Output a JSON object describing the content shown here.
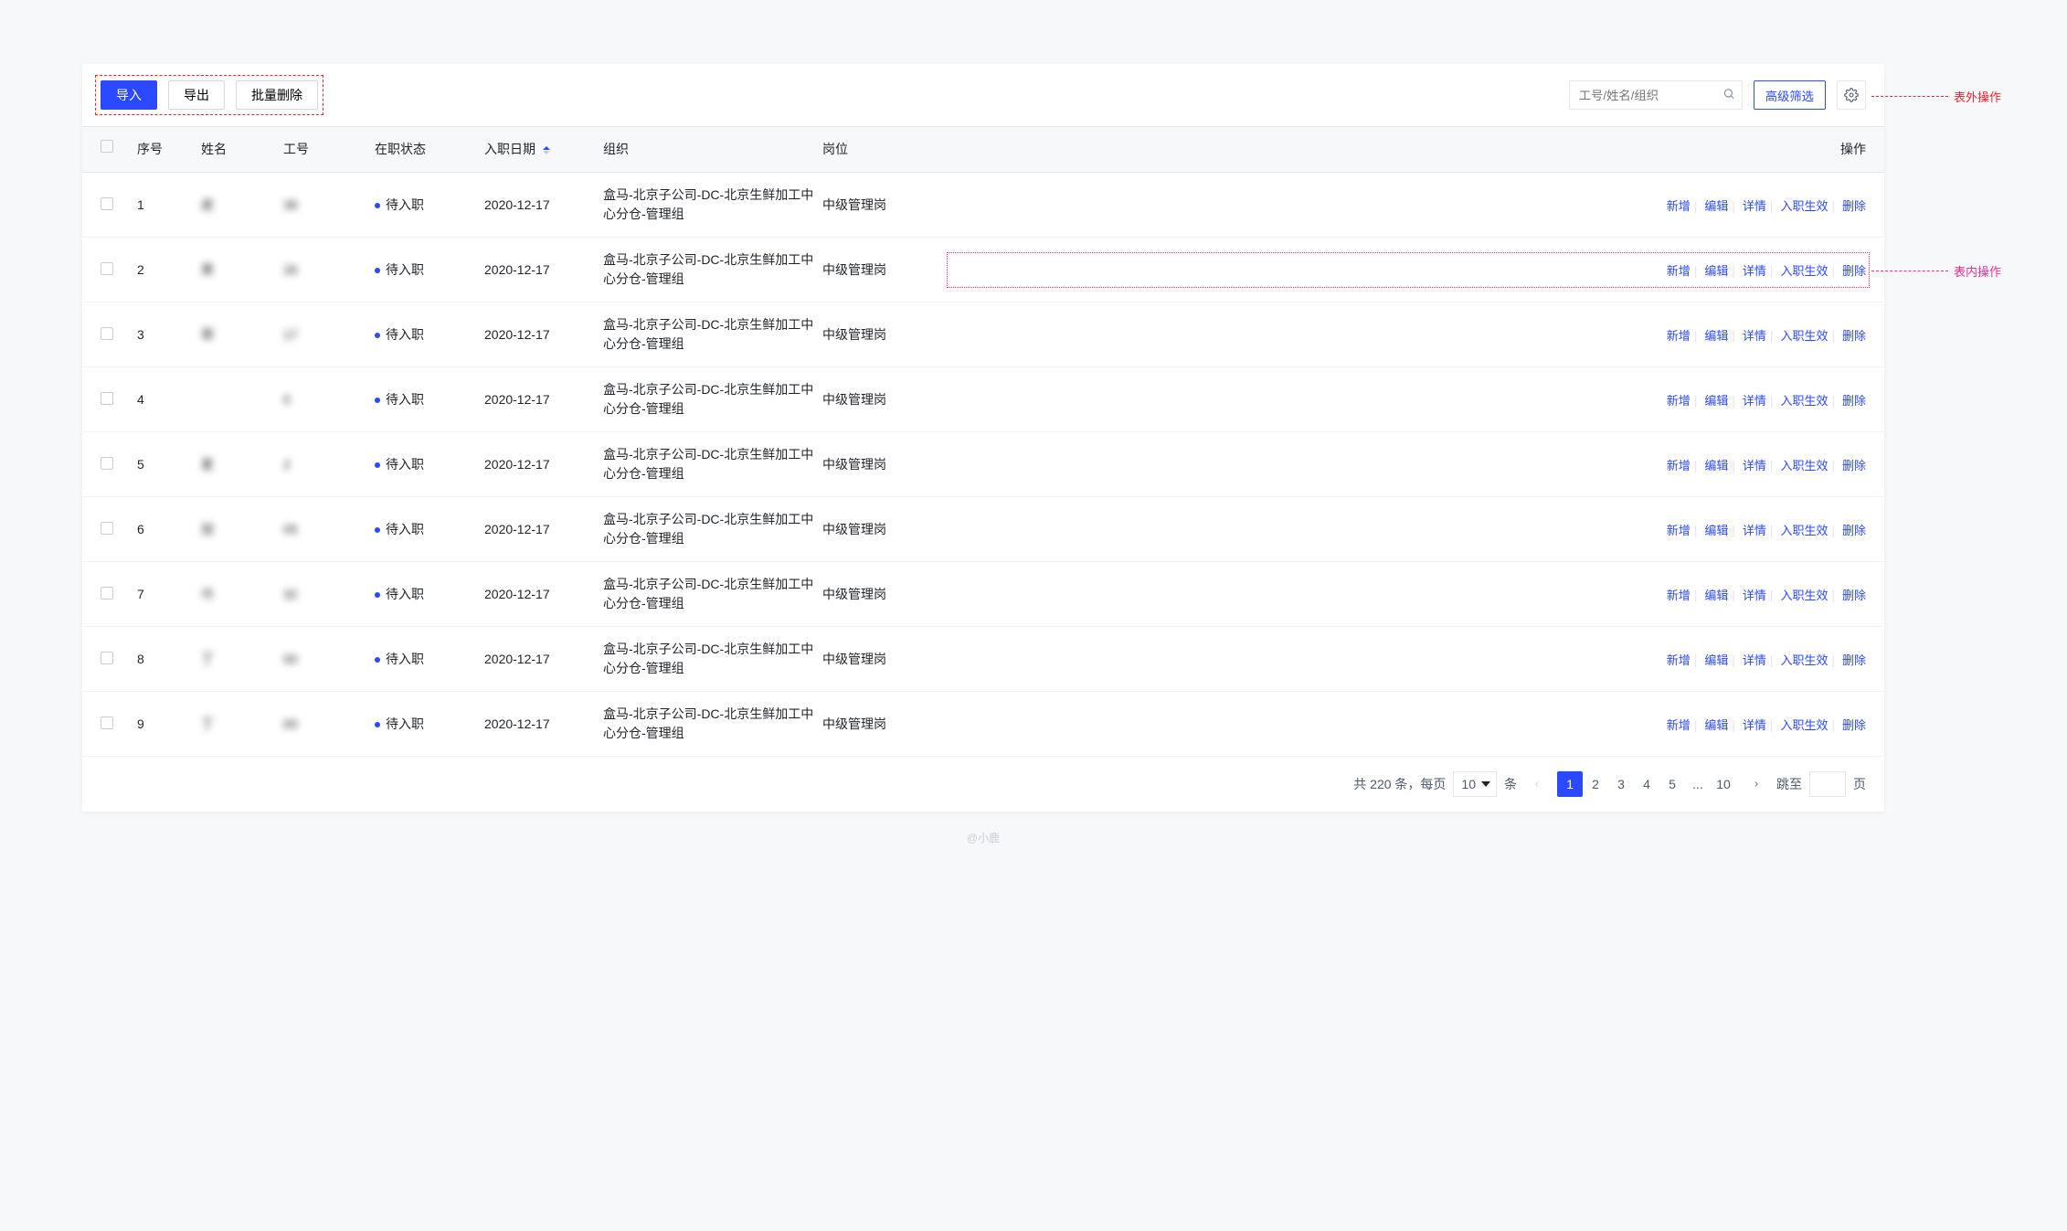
{
  "toolbar": {
    "import_label": "导入",
    "export_label": "导出",
    "batch_delete_label": "批量删除",
    "search_placeholder": "工号/姓名/组织",
    "adv_filter_label": "高级筛选"
  },
  "annotations": {
    "outer_action": "表外操作",
    "inner_action": "表内操作"
  },
  "columns": {
    "index": "序号",
    "name": "姓名",
    "emp_id": "工号",
    "status": "在职状态",
    "hire_date": "入职日期",
    "org": "组织",
    "position": "岗位",
    "action": "操作"
  },
  "row_actions": {
    "add": "新增",
    "edit": "编辑",
    "detail": "详情",
    "activate": "入职生效",
    "delete": "删除"
  },
  "rows": [
    {
      "index": "1",
      "name": "皮",
      "emp_id": "38",
      "status": "待入职",
      "date": "2020-12-17",
      "org": "盒马-北京子公司-DC-北京生鲜加工中心分仓-管理组",
      "position": "中级管理岗"
    },
    {
      "index": "2",
      "name": "昊",
      "emp_id": "26",
      "status": "待入职",
      "date": "2020-12-17",
      "org": "盒马-北京子公司-DC-北京生鲜加工中心分仓-管理组",
      "position": "中级管理岗"
    },
    {
      "index": "3",
      "name": "菲",
      "emp_id": "17",
      "status": "待入职",
      "date": "2020-12-17",
      "org": "盒马-北京子公司-DC-北京生鲜加工中心分仓-管理组",
      "position": "中级管理岗"
    },
    {
      "index": "4",
      "name": "",
      "emp_id": "0",
      "status": "待入职",
      "date": "2020-12-17",
      "org": "盒马-北京子公司-DC-北京生鲜加工中心分仓-管理组",
      "position": "中级管理岗"
    },
    {
      "index": "5",
      "name": "星",
      "emp_id": "2",
      "status": "待入职",
      "date": "2020-12-17",
      "org": "盒马-北京子公司-DC-北京生鲜加工中心分仓-管理组",
      "position": "中级管理岗"
    },
    {
      "index": "6",
      "name": "加",
      "emp_id": "05",
      "status": "待入职",
      "date": "2020-12-17",
      "org": "盒马-北京子公司-DC-北京生鲜加工中心分仓-管理组",
      "position": "中级管理岗"
    },
    {
      "index": "7",
      "name": "巾",
      "emp_id": "32",
      "status": "待入职",
      "date": "2020-12-17",
      "org": "盒马-北京子公司-DC-北京生鲜加工中心分仓-管理组",
      "position": "中级管理岗"
    },
    {
      "index": "8",
      "name": "丁",
      "emp_id": "00",
      "status": "待入职",
      "date": "2020-12-17",
      "org": "盒马-北京子公司-DC-北京生鲜加工中心分仓-管理组",
      "position": "中级管理岗"
    },
    {
      "index": "9",
      "name": "丁",
      "emp_id": "00",
      "status": "待入职",
      "date": "2020-12-17",
      "org": "盒马-北京子公司-DC-北京生鲜加工中心分仓-管理组",
      "position": "中级管理岗"
    }
  ],
  "pagination": {
    "total_prefix": "共 ",
    "total_count": "220",
    "total_suffix": " 条，每页",
    "page_size": "10",
    "page_size_suffix": "条",
    "pages": [
      "1",
      "2",
      "3",
      "4",
      "5",
      "...",
      "10"
    ],
    "jump_label": "跳至",
    "jump_suffix": "页"
  },
  "footer": "@小鹿"
}
